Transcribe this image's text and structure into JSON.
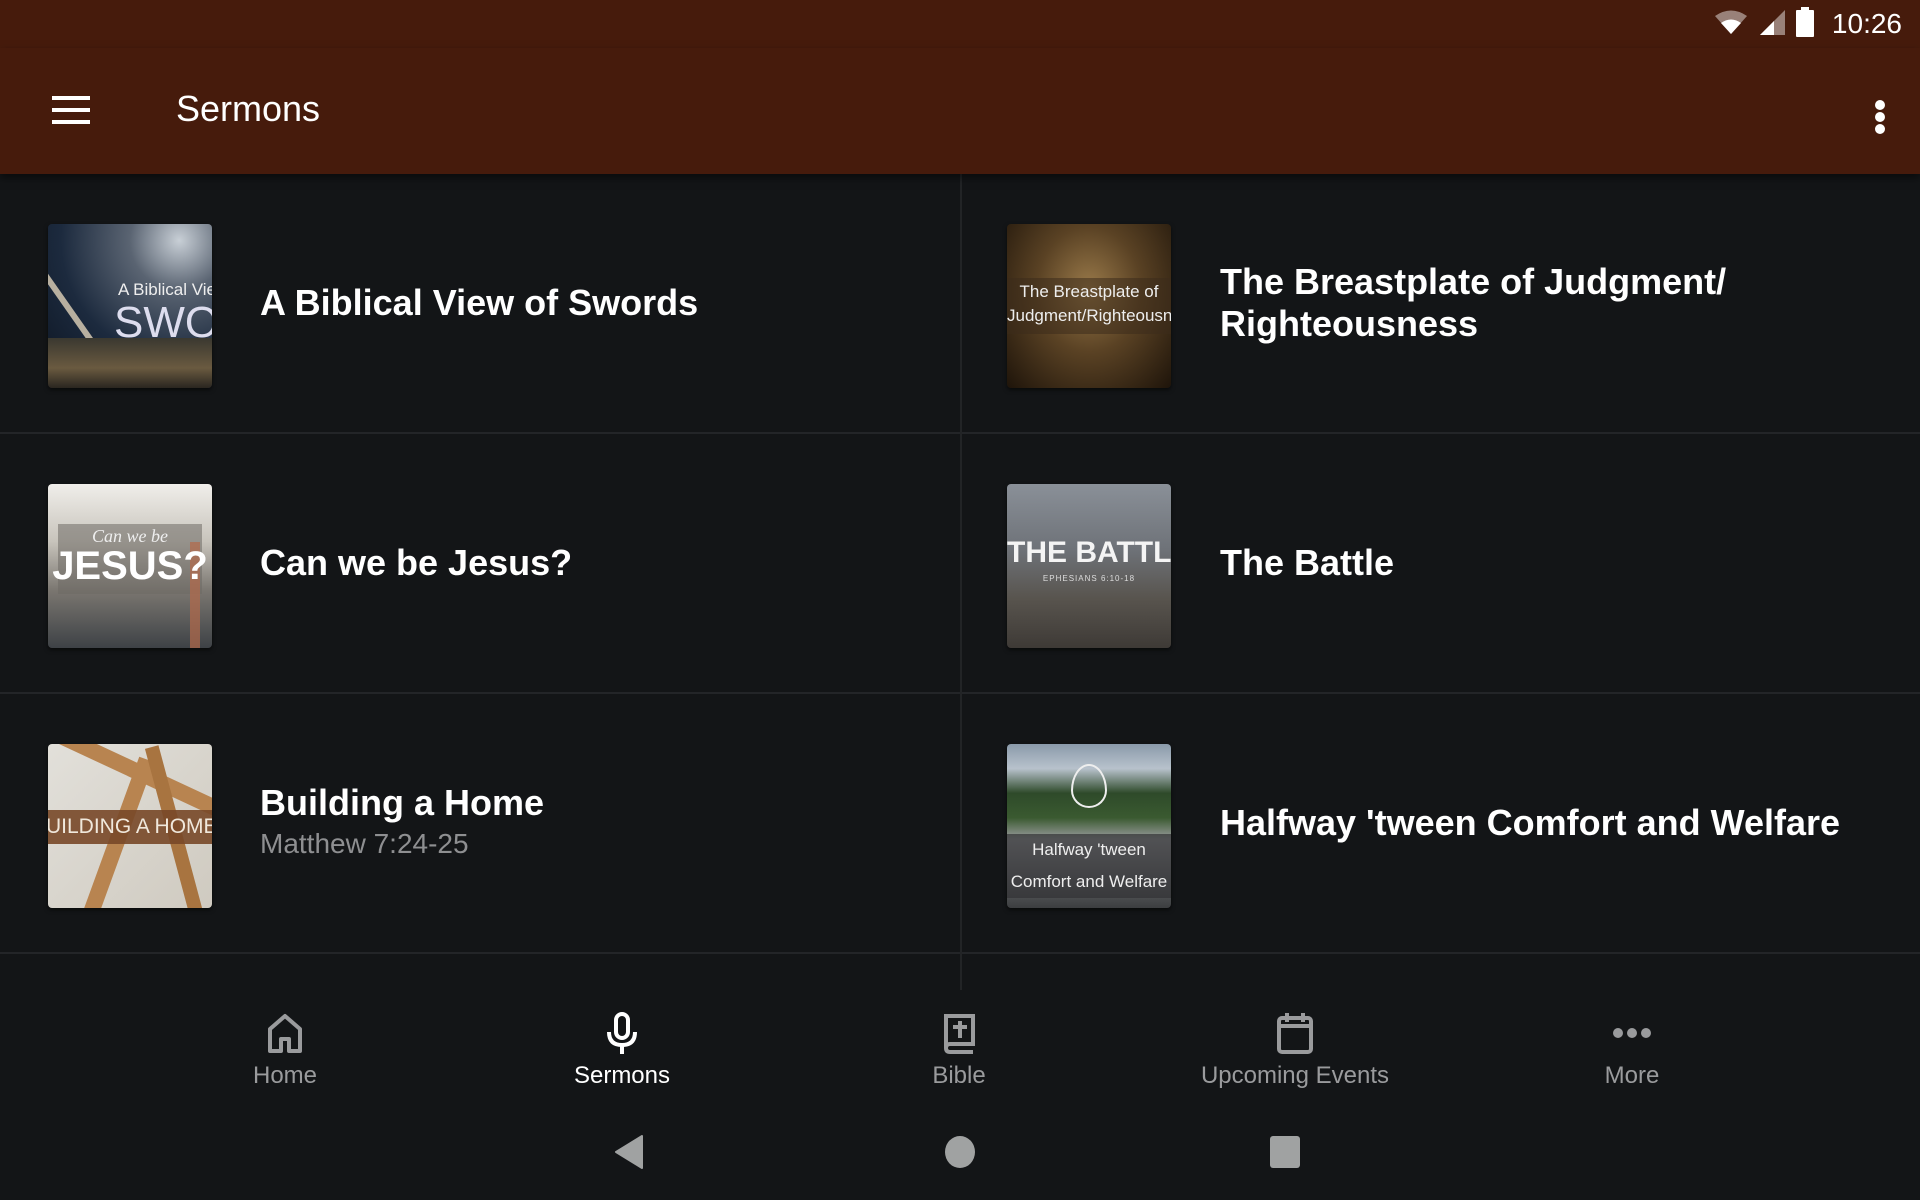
{
  "status_bar": {
    "time": "10:26",
    "icons": [
      "wifi-icon",
      "cell-signal-icon",
      "battery-icon"
    ]
  },
  "app_bar": {
    "title": "Sermons",
    "menu_icon": "hamburger-menu-icon",
    "overflow_icon": "more-vert-icon"
  },
  "sermons": [
    {
      "title": "A Biblical View of Swords",
      "subtitle": "",
      "thumbnail": {
        "line1": "A Biblical Vie",
        "line2": "SWOR",
        "colors": [
          "#1c2a3e",
          "#54606e"
        ]
      }
    },
    {
      "title": "The Breastplate of Judgment/ Righteousness",
      "subtitle": "",
      "thumbnail": {
        "line1": "The Breastplate of",
        "line2": "Judgment/Righteousness",
        "colors": [
          "#2a1c0c",
          "#8a6a3a"
        ]
      }
    },
    {
      "title": "Can we be Jesus?",
      "subtitle": "",
      "thumbnail": {
        "line1": "Can we be",
        "line2": "JESUS?",
        "colors": [
          "#e8e6e2",
          "#4a4e52"
        ]
      }
    },
    {
      "title": "The Battle",
      "subtitle": "",
      "thumbnail": {
        "line1": "THE BATTLE",
        "line2": "EPHESIANS 6:10-18",
        "colors": [
          "#7a7e84",
          "#4a4642"
        ]
      }
    },
    {
      "title": "Building a Home",
      "subtitle": "Matthew 7:24-25",
      "thumbnail": {
        "line1": "BUILDING A HOME",
        "line2": "",
        "colors": [
          "#d8d6d0",
          "#a8743e"
        ]
      }
    },
    {
      "title": "Halfway 'tween Comfort and Welfare",
      "subtitle": "",
      "thumbnail": {
        "line1": "Halfway 'tween",
        "line2": "Comfort and Welfare",
        "colors": [
          "#6a7a8a",
          "#3a3c3e"
        ]
      }
    }
  ],
  "bottom_nav": {
    "items": [
      {
        "label": "Home",
        "icon": "home-icon",
        "active": false
      },
      {
        "label": "Sermons",
        "icon": "microphone-icon",
        "active": true
      },
      {
        "label": "Bible",
        "icon": "bible-icon",
        "active": false
      },
      {
        "label": "Upcoming Events",
        "icon": "calendar-icon",
        "active": false
      },
      {
        "label": "More",
        "icon": "more-horiz-icon",
        "active": false
      }
    ]
  },
  "system_nav": {
    "buttons": [
      "back",
      "home",
      "recents"
    ]
  },
  "colors": {
    "app_bar": "#461b0c",
    "background": "#131517",
    "divider": "#232528",
    "inactive": "#9a9b9d",
    "active": "#ffffff"
  }
}
